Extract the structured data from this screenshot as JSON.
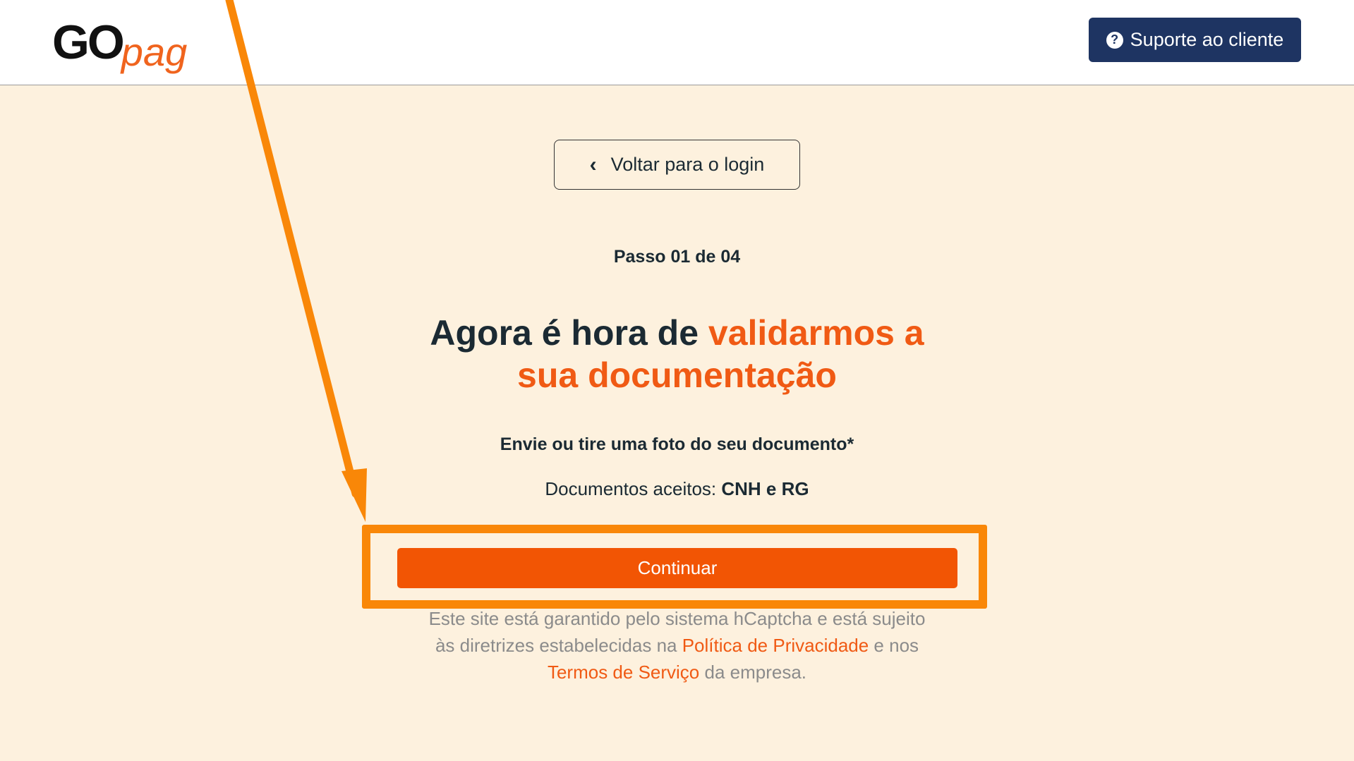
{
  "header": {
    "logo": {
      "part1": "GO",
      "part2": "pag"
    },
    "support_label": "Suporte ao cliente",
    "support_icon": "question-circle-icon"
  },
  "main": {
    "back_label": "Voltar para o login",
    "step": "Passo 01 de 04",
    "headline": {
      "line1_dark": "Agora é hora de ",
      "line1_accent": "validarmos a",
      "line2_accent": "sua documentação"
    },
    "subtitle": "Envie ou tire uma foto do seu documento*",
    "accepted_prefix": "Documentos aceitos: ",
    "accepted_docs": "CNH e RG",
    "continue_label": "Continuar",
    "legal": {
      "part1": "Este site está garantido pelo sistema hCaptcha e está sujeito",
      "part2": "às diretrizes estabelecidas na ",
      "privacy_link": "Política de Privacidade",
      "part3": " e nos",
      "terms_link": "Termos de Serviço",
      "part4": " da empresa."
    }
  },
  "colors": {
    "accent": "#f05a14",
    "button": "#f25504",
    "highlight": "#f98708",
    "navy": "#1e3462",
    "background": "#fdf1de"
  }
}
